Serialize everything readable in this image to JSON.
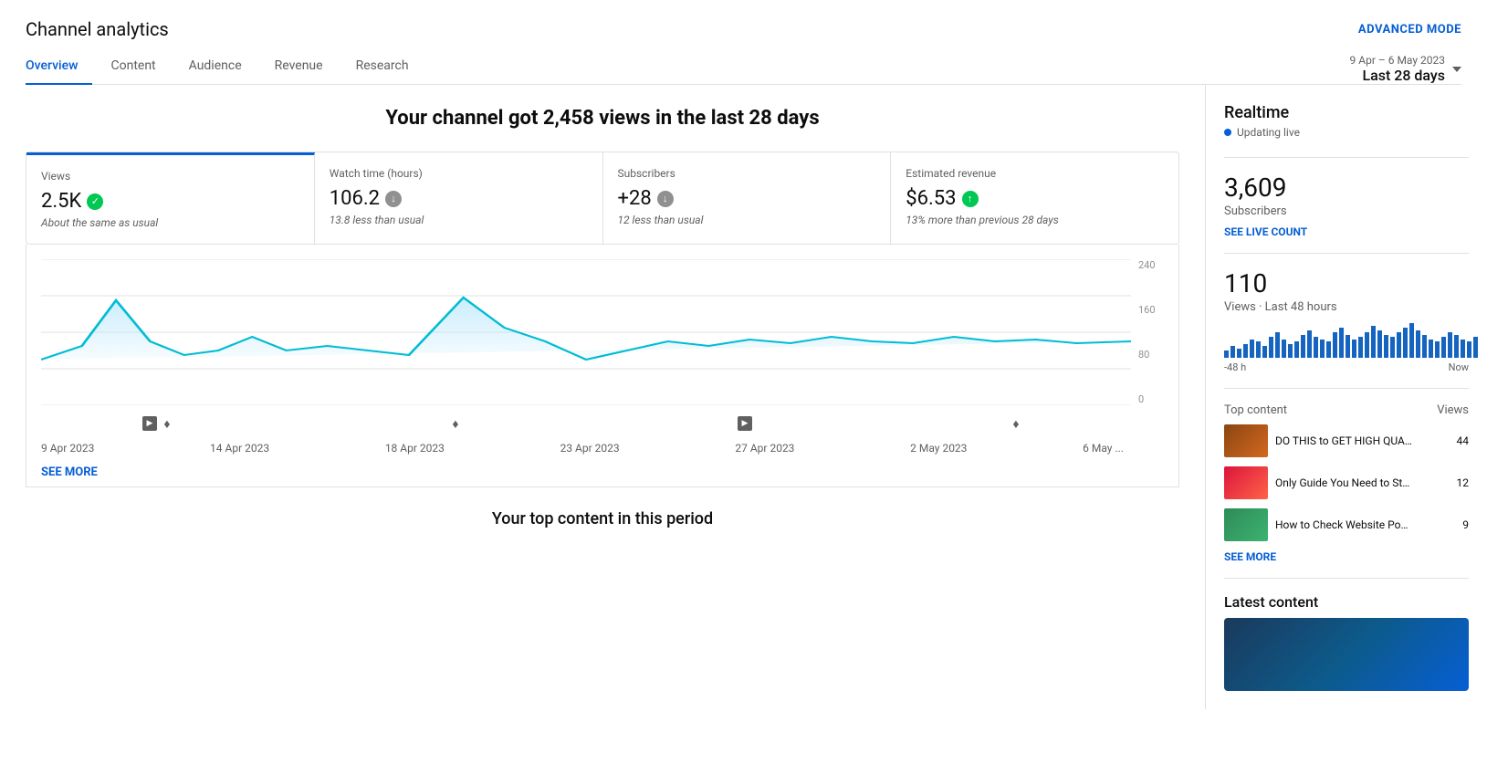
{
  "page": {
    "title": "Channel analytics",
    "advanced_mode_label": "ADVANCED MODE"
  },
  "nav": {
    "tabs": [
      {
        "id": "overview",
        "label": "Overview",
        "active": true
      },
      {
        "id": "content",
        "label": "Content",
        "active": false
      },
      {
        "id": "audience",
        "label": "Audience",
        "active": false
      },
      {
        "id": "revenue",
        "label": "Revenue",
        "active": false
      },
      {
        "id": "research",
        "label": "Research",
        "active": false
      }
    ]
  },
  "date_range": {
    "period": "9 Apr – 6 May 2023",
    "label": "Last 28 days"
  },
  "headline": "Your channel got 2,458 views in the last 28 days",
  "stats": [
    {
      "label": "Views",
      "value": "2.5K",
      "icon": "check",
      "comparison": "About the same as usual",
      "active": true
    },
    {
      "label": "Watch time (hours)",
      "value": "106.2",
      "icon": "down",
      "comparison": "13.8 less than usual",
      "active": false
    },
    {
      "label": "Subscribers",
      "value": "+28",
      "icon": "down",
      "comparison": "12 less than usual",
      "active": false
    },
    {
      "label": "Estimated revenue",
      "value": "$6.53",
      "icon": "up",
      "comparison": "13% more than previous 28 days",
      "active": false
    }
  ],
  "chart": {
    "x_labels": [
      "9 Apr 2023",
      "14 Apr 2023",
      "18 Apr 2023",
      "23 Apr 2023",
      "27 Apr 2023",
      "2 May 2023",
      "6 May ..."
    ],
    "y_labels": [
      "240",
      "160",
      "80",
      "0"
    ]
  },
  "see_more": "SEE MORE",
  "top_content_title": "Your top content in this period",
  "realtime": {
    "title": "Realtime",
    "updating_live": "Updating live",
    "subscribers": {
      "value": "3,609",
      "label": "Subscribers"
    },
    "see_live_count": "SEE LIVE COUNT",
    "views": {
      "value": "110",
      "label": "Views · Last 48 hours"
    },
    "time_labels": {
      "start": "-48 h",
      "end": "Now"
    },
    "top_content": {
      "label": "Top content",
      "views_label": "Views",
      "items": [
        {
          "title": "DO THIS to GET HIGH QUALI...",
          "views": 44
        },
        {
          "title": "Only Guide You Need to Star...",
          "views": 12
        },
        {
          "title": "How to Check Website Positio...",
          "views": 9
        }
      ]
    },
    "see_more": "SEE MORE",
    "latest_content": {
      "title": "Latest content"
    }
  },
  "bar_data": [
    3,
    5,
    4,
    6,
    8,
    7,
    5,
    9,
    11,
    8,
    6,
    7,
    10,
    12,
    9,
    8,
    7,
    11,
    13,
    10,
    8,
    9,
    11,
    14,
    12,
    10,
    9,
    11,
    13,
    15,
    12,
    10,
    8,
    7,
    9,
    11,
    10,
    8,
    7,
    9
  ]
}
